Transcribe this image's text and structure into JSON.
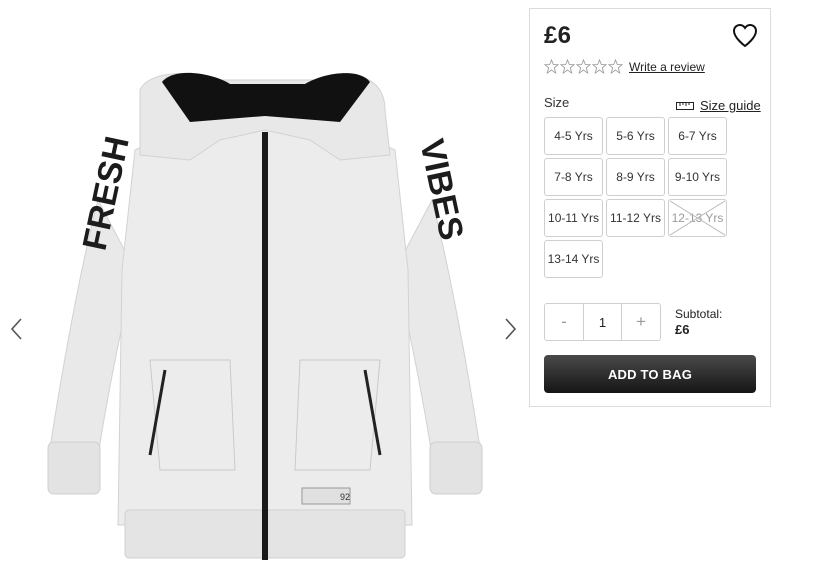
{
  "gallery": {
    "prev_icon": "chevron-left-icon",
    "next_icon": "chevron-right-icon",
    "image": {
      "description_name": "grey-hoodie",
      "colors": {
        "body": "#ebebeb",
        "hood_lining": "#111111",
        "print": "#1c1c1c"
      },
      "print_left": "FRESH",
      "print_right": "VIBES",
      "label_number": "92"
    }
  },
  "product": {
    "price": "£6",
    "wishlist_icon": "heart-icon",
    "rating": {
      "stars": 0,
      "max": 5,
      "review_link": "Write a review"
    },
    "size": {
      "label": "Size",
      "guide_label": "Size guide",
      "guide_icon": "ruler-icon",
      "options": [
        {
          "label": "4-5 Yrs",
          "available": true
        },
        {
          "label": "5-6 Yrs",
          "available": true
        },
        {
          "label": "6-7 Yrs",
          "available": true
        },
        {
          "label": "7-8 Yrs",
          "available": true
        },
        {
          "label": "8-9 Yrs",
          "available": true
        },
        {
          "label": "9-10 Yrs",
          "available": true
        },
        {
          "label": "10-11 Yrs",
          "available": true
        },
        {
          "label": "11-12 Yrs",
          "available": true
        },
        {
          "label": "12-13 Yrs",
          "available": false
        },
        {
          "label": "13-14 Yrs",
          "available": true
        }
      ]
    },
    "quantity": {
      "decrement": "-",
      "value": "1",
      "increment": "+"
    },
    "subtotal": {
      "label": "Subtotal:",
      "value": "£6"
    },
    "add_to_bag": "ADD TO BAG"
  },
  "colors": {
    "button_dark": "#1e1e1e",
    "border": "#dcdcdc",
    "accent_text": "#222222"
  }
}
